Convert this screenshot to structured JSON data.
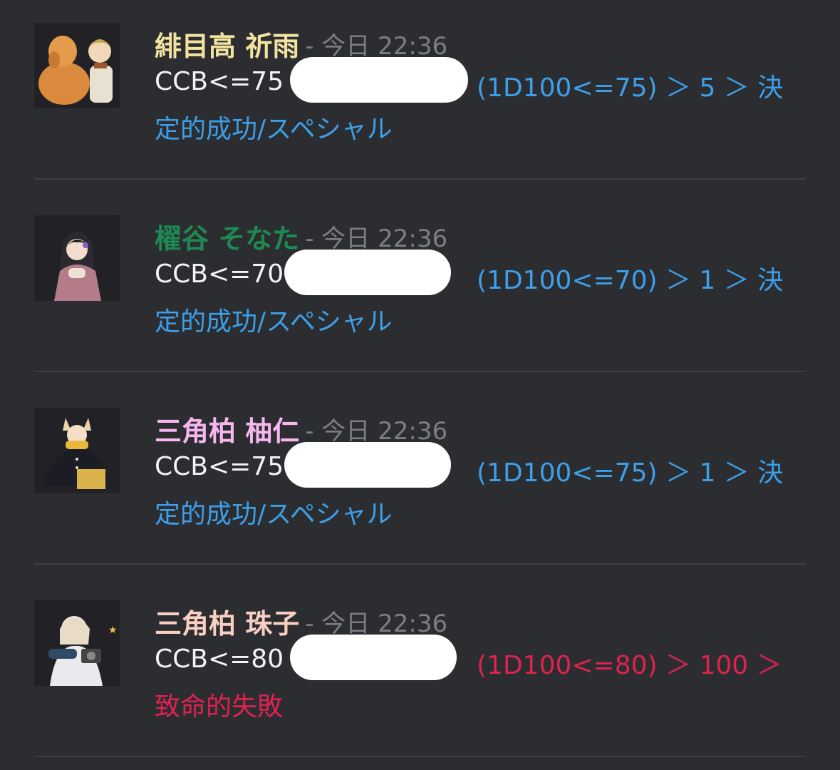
{
  "messages": [
    {
      "name": "緋目高 祈雨",
      "name_color": "#f3e3a0",
      "time": "- 今日 22:36",
      "command": "CCB<=75",
      "result_line1": "(1D100<=75) ＞ 5 ＞ 決",
      "result_line2": "定的成功/スペシャル",
      "result_color": "#3d9fe8",
      "avatar_icon": "character-with-dog-avatar"
    },
    {
      "name": "櫂谷 そなた",
      "name_color": "#1e8a52",
      "time": "- 今日 22:36",
      "command": "CCB<=70",
      "result_line1": "(1D100<=70) ＞ 1 ＞ 決",
      "result_line2": "定的成功/スペシャル",
      "result_color": "#3d9fe8",
      "avatar_icon": "character-pink-coat-avatar"
    },
    {
      "name": "三角柏 柚仁",
      "name_color": "#f6b7ee",
      "time": "- 今日 22:36",
      "command": "CCB<=75",
      "result_line1": "(1D100<=75) ＞ 1 ＞ 決",
      "result_line2": "定的成功/スペシャル",
      "result_color": "#3d9fe8",
      "avatar_icon": "character-cat-ears-avatar"
    },
    {
      "name": "三角柏 珠子",
      "name_color": "#f8cfc0",
      "time": "- 今日 22:36",
      "command": "CCB<=80",
      "result_line1": "(1D100<=80) ＞ 100 ＞",
      "result_line2": "致命的失敗",
      "result_color": "#e0224f",
      "avatar_icon": "character-camera-avatar"
    }
  ]
}
